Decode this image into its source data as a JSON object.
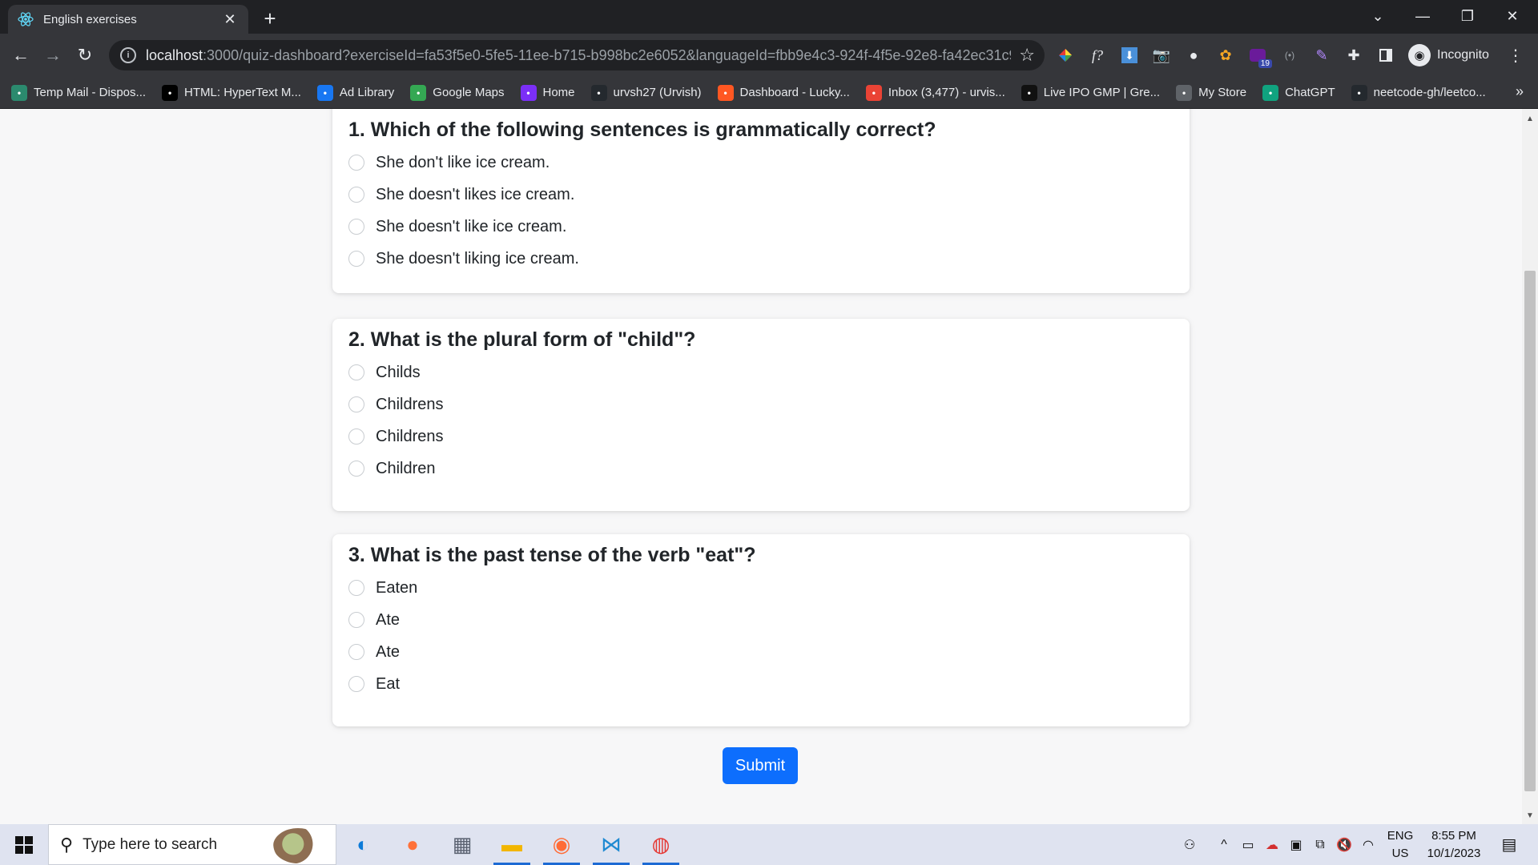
{
  "browser": {
    "tab_title": "English exercises",
    "url_host": "localhost",
    "url_rest": ":3000/quiz-dashboard?exerciseId=fa53f5e0-5fe5-11ee-b715-b998bc2e6052&languageId=fbb9e4c3-924f-4f5e-92e8-fa42ec31c91...",
    "profile_label": "Incognito",
    "extension_badge": "19",
    "bookmarks": [
      {
        "label": "Temp Mail - Dispos...",
        "icon": "temp-mail-icon",
        "color": "#2b8a6e"
      },
      {
        "label": "HTML: HyperText M...",
        "icon": "mdn-icon",
        "color": "#000000"
      },
      {
        "label": "Ad Library",
        "icon": "meta-icon",
        "color": "#1877f2"
      },
      {
        "label": "Google Maps",
        "icon": "google-maps-icon",
        "color": "#34a853"
      },
      {
        "label": "Home",
        "icon": "home-site-icon",
        "color": "#7b2ff7"
      },
      {
        "label": "urvsh27 (Urvish)",
        "icon": "github-icon",
        "color": "#24292e"
      },
      {
        "label": "Dashboard - Lucky...",
        "icon": "dashboard-icon",
        "color": "#ff5722"
      },
      {
        "label": "Inbox (3,477) - urvis...",
        "icon": "gmail-icon",
        "color": "#ea4335"
      },
      {
        "label": "Live IPO GMP | Gre...",
        "icon": "ipo-icon",
        "color": "#111111"
      },
      {
        "label": "My Store",
        "icon": "store-icon",
        "color": "#5f6368"
      },
      {
        "label": "ChatGPT",
        "icon": "chatgpt-icon",
        "color": "#10a37f"
      },
      {
        "label": "neetcode-gh/leetco...",
        "icon": "github-icon",
        "color": "#24292e"
      }
    ]
  },
  "quiz": {
    "questions": [
      {
        "title": "1. Which of the following sentences is grammatically correct?",
        "options": [
          "She don't like ice cream.",
          "She doesn't likes ice cream.",
          "She doesn't like ice cream.",
          "She doesn't liking ice cream."
        ]
      },
      {
        "title": "2. What is the plural form of \"child\"?",
        "options": [
          "Childs",
          "Childrens",
          "Childrens",
          "Children"
        ]
      },
      {
        "title": "3. What is the past tense of the verb \"eat\"?",
        "options": [
          "Eaten",
          "Ate",
          "Ate",
          "Eat"
        ]
      }
    ],
    "submit_label": "Submit",
    "accent_color": "#0d6efd"
  },
  "taskbar": {
    "search_placeholder": "Type here to search",
    "language": "ENG",
    "region": "US",
    "time": "8:55 PM",
    "date": "10/1/2023"
  }
}
